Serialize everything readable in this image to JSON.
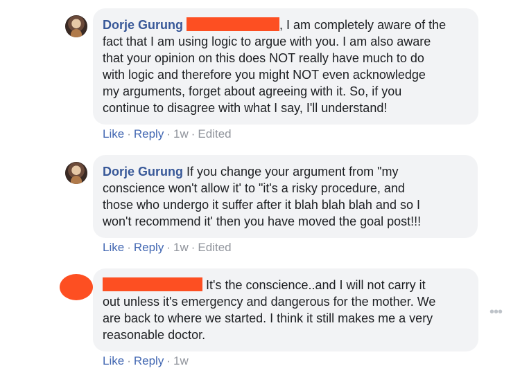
{
  "comments": [
    {
      "author": "Dorje Gurung",
      "text_lines": [
        ", I am completely aware of the",
        "fact that I am using logic to argue with you. I am also aware",
        "that your opinion on this does NOT really have much to do",
        "with logic and therefore you might NOT even acknowledge",
        "my arguments, forget about agreeing with it. So, if you",
        "continue to disagree with what I say, I'll understand!"
      ],
      "like": "Like",
      "reply": "Reply",
      "time": "1w",
      "edited": "Edited",
      "dot": "·"
    },
    {
      "author": "Dorje Gurung",
      "text_lines": [
        " If you change your argument from \"my",
        "conscience won't allow it' to \"it's a risky procedure, and",
        "those who undergo it suffer after it blah blah blah and so I",
        "won't recommend it' then you have moved the goal post!!!"
      ],
      "like": "Like",
      "reply": "Reply",
      "time": "1w",
      "edited": "Edited",
      "dot": "·"
    },
    {
      "text_lines": [
        " It's the conscience..and I will not carry it",
        "out unless it's emergency and dangerous for the mother. We",
        "are back to where we started. I think it still makes me a very",
        "reasonable doctor."
      ],
      "like": "Like",
      "reply": "Reply",
      "time": "1w",
      "dot": "·"
    }
  ],
  "more_icon_glyph": "•••",
  "colors": {
    "redaction": "#fd4f22",
    "link": "#4267b2",
    "author": "#385898",
    "bubble": "#f2f3f5"
  }
}
